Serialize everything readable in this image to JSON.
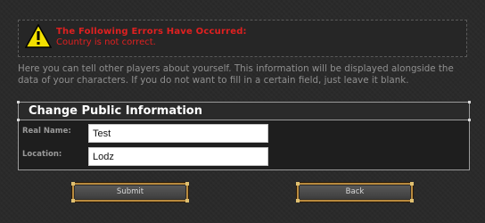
{
  "errors": {
    "title": "The Following Errors Have Occurred:",
    "messages": [
      "Country is not correct."
    ],
    "icon": "warning-icon"
  },
  "intro_text": "Here you can tell other players about yourself. This information will be displayed alongside the data of your characters. If you do not want to fill in a certain field, just leave it blank.",
  "panel": {
    "title": "Change Public Information",
    "fields": [
      {
        "label": "Real Name:",
        "value": "Test"
      },
      {
        "label": "Location:",
        "value": "Lodz"
      }
    ]
  },
  "buttons": {
    "submit_label": "Submit",
    "back_label": "Back"
  },
  "colors": {
    "error": "#e02020",
    "button_border": "#b88a3e"
  }
}
